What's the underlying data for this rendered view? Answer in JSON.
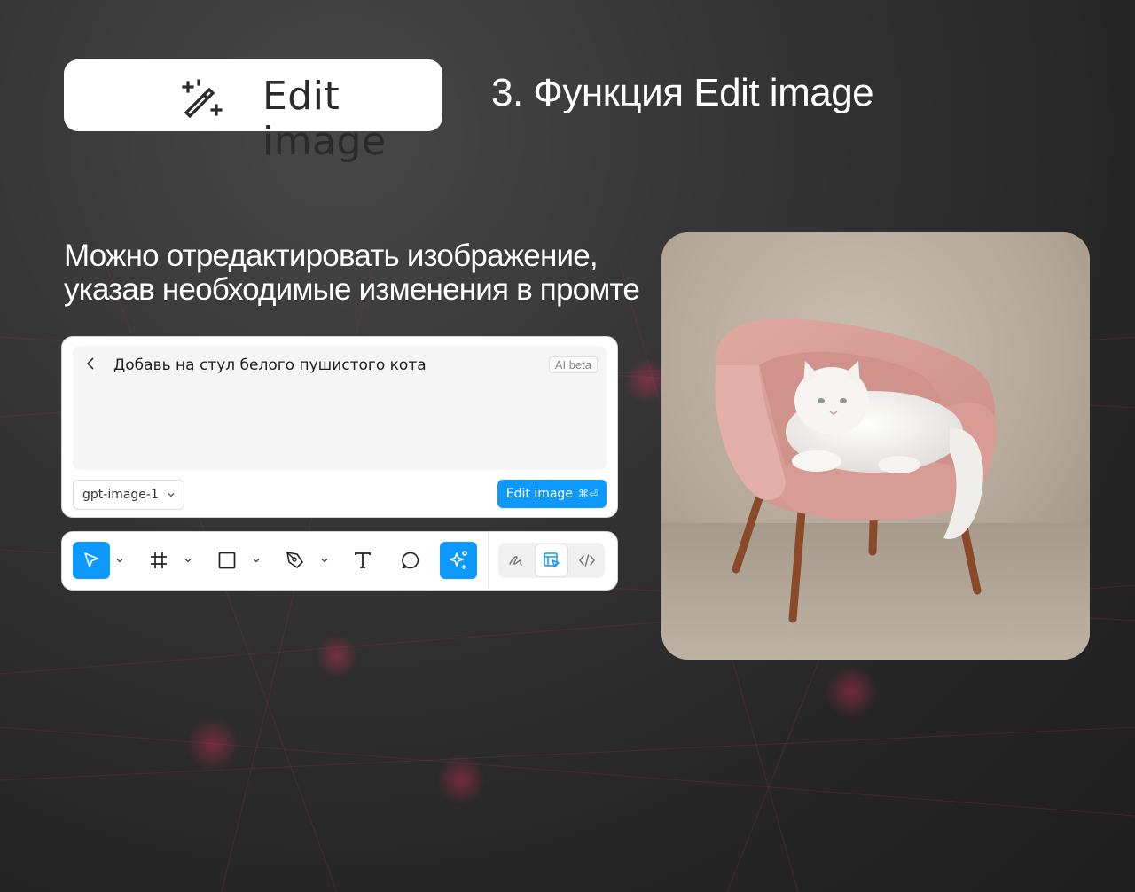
{
  "badge": {
    "label": "Edit image",
    "icon": "magic-wand-icon"
  },
  "heading": "3. Функция Edit image",
  "description": {
    "line1": "Можно отредактировать изображение,",
    "line2": "указав необходимые изменения в промте"
  },
  "prompt_panel": {
    "prompt_text": "Добавь на стул белого пушистого кота",
    "ai_badge": "AI beta",
    "model": "gpt-image-1",
    "edit_button": "Edit image",
    "edit_shortcut": "⌘⏎"
  },
  "toolbar": {
    "tools": [
      "move-icon",
      "frame-icon",
      "rectangle-icon",
      "pen-icon",
      "text-icon",
      "comment-icon",
      "ai-actions-icon"
    ],
    "active_tool": "ai-actions-icon",
    "modes": [
      "draw-icon",
      "design-icon",
      "dev-mode-icon"
    ],
    "active_mode": "design-icon"
  },
  "colors": {
    "accent": "#0d99ff",
    "chair": "#d49a94",
    "wall": "#b8ab9c",
    "cat": "#f4f4f2"
  }
}
